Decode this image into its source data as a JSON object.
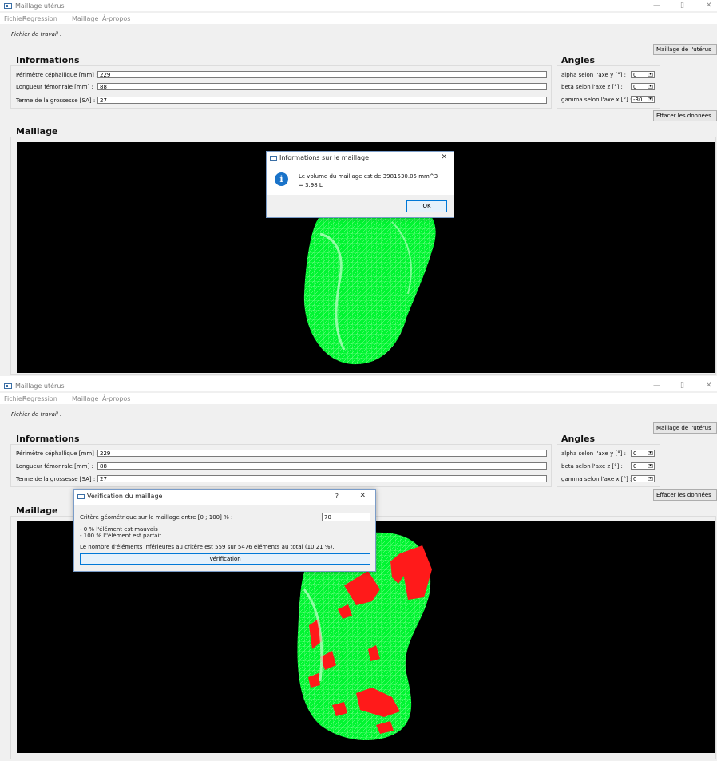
{
  "app": {
    "window_title": "Maillage utérus",
    "menu": [
      "Fichier",
      "Regression",
      "Maillage",
      "À-propos"
    ],
    "workfile_label": "Fichier de travail :",
    "controls": {
      "minimize": "—",
      "restore": "▯",
      "close": "✕"
    }
  },
  "info": {
    "title": "Informations",
    "fields": [
      {
        "label": "Périmètre céphallique [mm] :",
        "value": "229"
      },
      {
        "label": "Longueur fémonrale [mm] :",
        "value": "88"
      },
      {
        "label": "Terme de la grossesse [SA] :",
        "value": "27"
      }
    ]
  },
  "angles": {
    "title": "Angles",
    "top": [
      {
        "label": "alpha selon l'axe y [°] :",
        "value": "0"
      },
      {
        "label": "beta selon l'axe z [°] :",
        "value": "0"
      },
      {
        "label": "gamma selon l'axe x [°] :",
        "value": "-30"
      }
    ],
    "bottom": [
      {
        "label": "alpha selon l'axe y [°] :",
        "value": "0"
      },
      {
        "label": "beta selon l'axe z [°] :",
        "value": "0"
      },
      {
        "label": "gamma selon l'axe x [°] :",
        "value": "0"
      }
    ]
  },
  "buttons": {
    "mesh": "Maillage de l'utérus",
    "clear": "Effacer les données"
  },
  "mesh_section": {
    "title": "Maillage"
  },
  "info_dialog": {
    "title": "Informations sur le maillage",
    "message_line1": "Le volume du maillage est de 3981530.05 mm^3",
    "message_line2": "= 3.98 L",
    "ok": "OK",
    "close": "✕"
  },
  "verif_dialog": {
    "title": "Vérification du maillage",
    "help": "?",
    "close": "✕",
    "criterion_label": "Critère géométrique sur le maillage entre [0 ; 100] % :",
    "criterion_value": "70",
    "note1": "- 0 % l'élément est mauvais",
    "note2": "- 100 % l''élément est parfait",
    "result": "Le nombre d'éléments inférieures au critère est 559 sur 5476 éléments au total (10.21 %).",
    "button": "Vérification"
  },
  "colors": {
    "mesh_green": "#00ff33",
    "bad_elements_red": "#ff1a1a",
    "info_icon": "#1a73c9"
  }
}
